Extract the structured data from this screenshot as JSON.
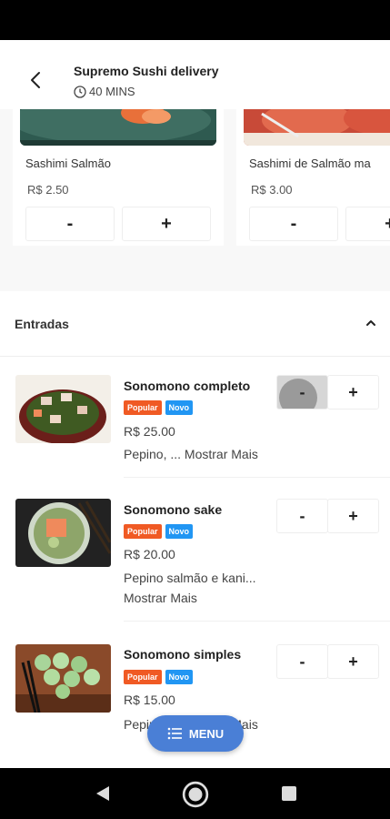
{
  "header": {
    "title": "Supremo Sushi delivery",
    "eta": "40 MINS"
  },
  "featured": [
    {
      "name": "Sashimi Salmão",
      "price": "R$ 2.50",
      "minus": "-",
      "plus": "+"
    },
    {
      "name": "Sashimi de Salmão ma",
      "price": "R$ 3.00",
      "minus": "-",
      "plus": "+"
    }
  ],
  "section": {
    "title": "Entradas"
  },
  "items": [
    {
      "name": "Sonomono completo",
      "badges": [
        "Popular",
        "Novo"
      ],
      "price": "R$ 25.00",
      "desc": "Pepino, ... Mostrar Mais",
      "minus": "-",
      "plus": "+"
    },
    {
      "name": "Sonomono sake",
      "badges": [
        "Popular",
        "Novo"
      ],
      "price": "R$ 20.00",
      "desc": "Pepino salmão e kani... Mostrar Mais",
      "minus": "-",
      "plus": "+"
    },
    {
      "name": "Sonomono simples",
      "badges": [
        "Popular",
        "Novo"
      ],
      "price": "R$ 15.00",
      "desc": "Pepino, ... Mostrar Mais",
      "minus": "-",
      "plus": "+"
    }
  ],
  "fab": {
    "label": "MENU"
  },
  "colors": {
    "accent": "#4a7fd6",
    "popular": "#f05a24",
    "novo": "#2196f3"
  }
}
